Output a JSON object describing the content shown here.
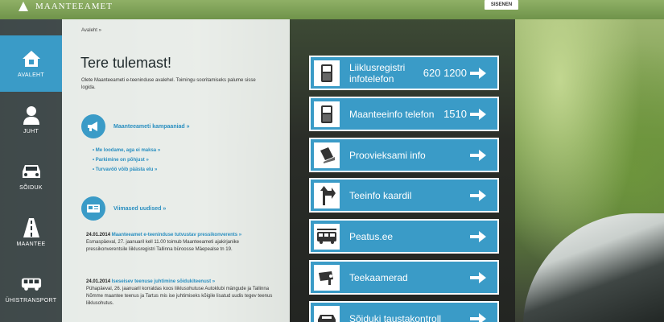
{
  "header": {
    "logo_text": "MAANTEEAMET",
    "login_label": "SISENEN"
  },
  "sidebar": {
    "items": [
      {
        "label": "AVALEHT",
        "icon": "home-icon",
        "active": true
      },
      {
        "label": "JUHT",
        "icon": "person-icon",
        "active": false
      },
      {
        "label": "SÕIDUK",
        "icon": "car-icon",
        "active": false
      },
      {
        "label": "MAANTEE",
        "icon": "road-icon",
        "active": false
      },
      {
        "label": "ÜHISTRANSPORT",
        "icon": "bus-icon",
        "active": false
      }
    ]
  },
  "main": {
    "breadcrumb": "Avaleht »",
    "title": "Tere tulemast!",
    "intro": "Olete Maanteeameti e-teeninduse avalehel. Toimingu sooritamiseks palume sisse logida.",
    "campaigns": {
      "icon": "megaphone-icon",
      "link": "Maanteeameti kampaaniad »",
      "items": [
        "Me loodame, aga ei maksa »",
        "Parkimine on põhjust »",
        "Turvavöö võib päästa elu »"
      ]
    },
    "news": {
      "icon": "newspaper-icon",
      "link": "Viimased uudised »",
      "items": [
        {
          "date": "24.01.2014",
          "title": "Maanteeamet e-teeninduse tutvustav pressikonverents »",
          "body": "Esmaspäeval, 27. jaanuaril kell 11.00 toimub Maanteeameti ajakirjanike pressikonverentsile liiklusregistri Tallinna büroosse Mäepealse tn 19."
        },
        {
          "date": "24.01.2014",
          "title": "Iseseisev teenuse juhtimine sõidukiteenust »",
          "body": "Pühapäeval, 26. jaanuaril korraldas koos liiklusohutuse Autoklubi mängude ja Tallinna Nõmme maantee teenus ja Tartus mis ise juhtimiseks kõigile lisatud uudis tegev teenus liiklusohutus."
        }
      ]
    }
  },
  "info_buttons": [
    {
      "label": "Liiklusregistri infotelefon",
      "number": "620 1200",
      "icon": "phone-icon"
    },
    {
      "label": "Maanteeinfo telefon",
      "number": "1510",
      "icon": "phone-icon"
    },
    {
      "label": "Proovieksami info",
      "number": "",
      "icon": "exam-icon"
    },
    {
      "label": "Teeinfo kaardil",
      "number": "",
      "icon": "road-sign-icon"
    },
    {
      "label": "Peatus.ee",
      "number": "",
      "icon": "bus-icon"
    },
    {
      "label": "Teekaamerad",
      "number": "",
      "icon": "camera-icon"
    },
    {
      "label": "Sõiduki taustakontroll",
      "number": "",
      "icon": "car-check-icon"
    }
  ],
  "colors": {
    "accent": "#3a9bc7",
    "topbar": "#7fa257",
    "sidebar": "#2b3538"
  }
}
